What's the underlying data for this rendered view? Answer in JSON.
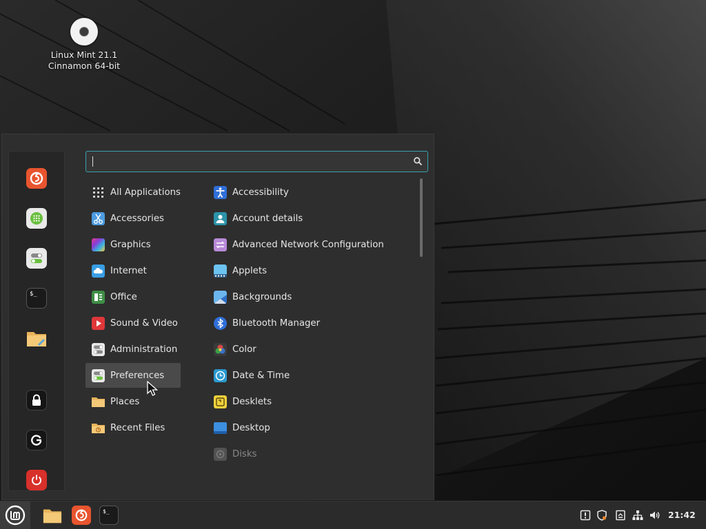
{
  "desktop": {
    "icon_label_line1": "Linux Mint 21.1",
    "icon_label_line2": "Cinnamon 64-bit"
  },
  "menu": {
    "search": {
      "value": "",
      "placeholder": ""
    },
    "favorites": [
      {
        "name": "firefox",
        "icon": "firefox-icon"
      },
      {
        "name": "software-manager",
        "icon": "software-manager-icon"
      },
      {
        "name": "system-settings",
        "icon": "system-settings-icon"
      },
      {
        "name": "terminal",
        "icon": "terminal-icon",
        "text": "$_"
      },
      {
        "name": "files",
        "icon": "folder-icon"
      },
      {
        "name": "lock-screen",
        "icon": "lock-icon"
      },
      {
        "name": "logout",
        "icon": "logout-icon"
      },
      {
        "name": "quit",
        "icon": "power-icon"
      }
    ],
    "categories": [
      {
        "label": "All Applications",
        "icon": "grid-icon"
      },
      {
        "label": "Accessories",
        "icon": "scissors-icon"
      },
      {
        "label": "Graphics",
        "icon": "graphics-icon"
      },
      {
        "label": "Internet",
        "icon": "cloud-icon"
      },
      {
        "label": "Office",
        "icon": "office-icon"
      },
      {
        "label": "Sound & Video",
        "icon": "play-icon"
      },
      {
        "label": "Administration",
        "icon": "toggles-icon"
      },
      {
        "label": "Preferences",
        "icon": "toggles-icon",
        "selected": true
      },
      {
        "label": "Places",
        "icon": "folder-icon"
      },
      {
        "label": "Recent Files",
        "icon": "recent-folder-icon"
      }
    ],
    "apps": [
      {
        "label": "Accessibility",
        "icon": "accessibility-icon"
      },
      {
        "label": "Account details",
        "icon": "account-icon"
      },
      {
        "label": "Advanced Network Configuration",
        "icon": "network-config-icon"
      },
      {
        "label": "Applets",
        "icon": "applets-icon"
      },
      {
        "label": "Backgrounds",
        "icon": "backgrounds-icon"
      },
      {
        "label": "Bluetooth Manager",
        "icon": "bluetooth-icon"
      },
      {
        "label": "Color",
        "icon": "color-icon"
      },
      {
        "label": "Date & Time",
        "icon": "clock-icon"
      },
      {
        "label": "Desklets",
        "icon": "desklets-icon"
      },
      {
        "label": "Desktop",
        "icon": "desktop-icon"
      },
      {
        "label": "Disks",
        "icon": "disks-icon",
        "dimmed": true
      }
    ]
  },
  "panel": {
    "launchers": [
      {
        "name": "files",
        "icon": "folder-icon"
      },
      {
        "name": "firefox",
        "icon": "firefox-icon"
      },
      {
        "name": "terminal",
        "icon": "terminal-icon",
        "text": "$_"
      }
    ],
    "tray": [
      "update-manager-icon",
      "shield-icon",
      "clipboard-icon",
      "network-icon",
      "volume-icon"
    ],
    "clock": "21:42"
  }
}
